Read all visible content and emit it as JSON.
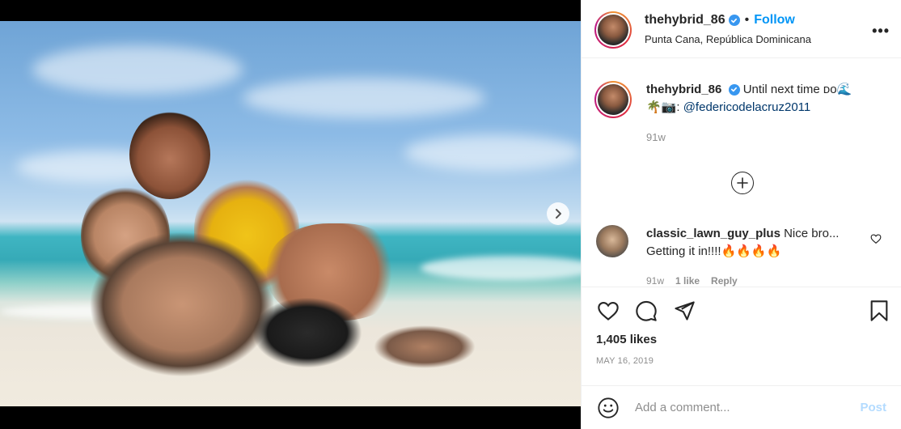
{
  "post": {
    "username": "thehybrid_86",
    "follow_label": "Follow",
    "bullet": "•",
    "location": "Punta Cana, República Dominicana",
    "more_label": "•••"
  },
  "caption": {
    "username": "thehybrid_86",
    "text": "Until next time ",
    "emojis_1": "ᴅᴏ🌊",
    "emojis_2": "🌴📷: ",
    "mention": "@federicodelacruz2011",
    "time": "91w"
  },
  "comment": {
    "username": "classic_lawn_guy_plus",
    "text_1": "Nice bro...",
    "text_2": "Getting it in!!!!🔥🔥🔥🔥",
    "time": "91w",
    "likes": "1 like",
    "reply": "Reply"
  },
  "stats": {
    "likes": "1,405 likes",
    "date": "MAY 16, 2019"
  },
  "add_comment": {
    "placeholder": "Add a comment...",
    "post_label": "Post"
  },
  "carousel": {
    "slide_count": 2,
    "active_index": 1
  },
  "colors": {
    "follow": "#0095f6",
    "verified": "#3897f0",
    "post_disabled": "#b3dbff",
    "muted": "#8e8e8e"
  }
}
